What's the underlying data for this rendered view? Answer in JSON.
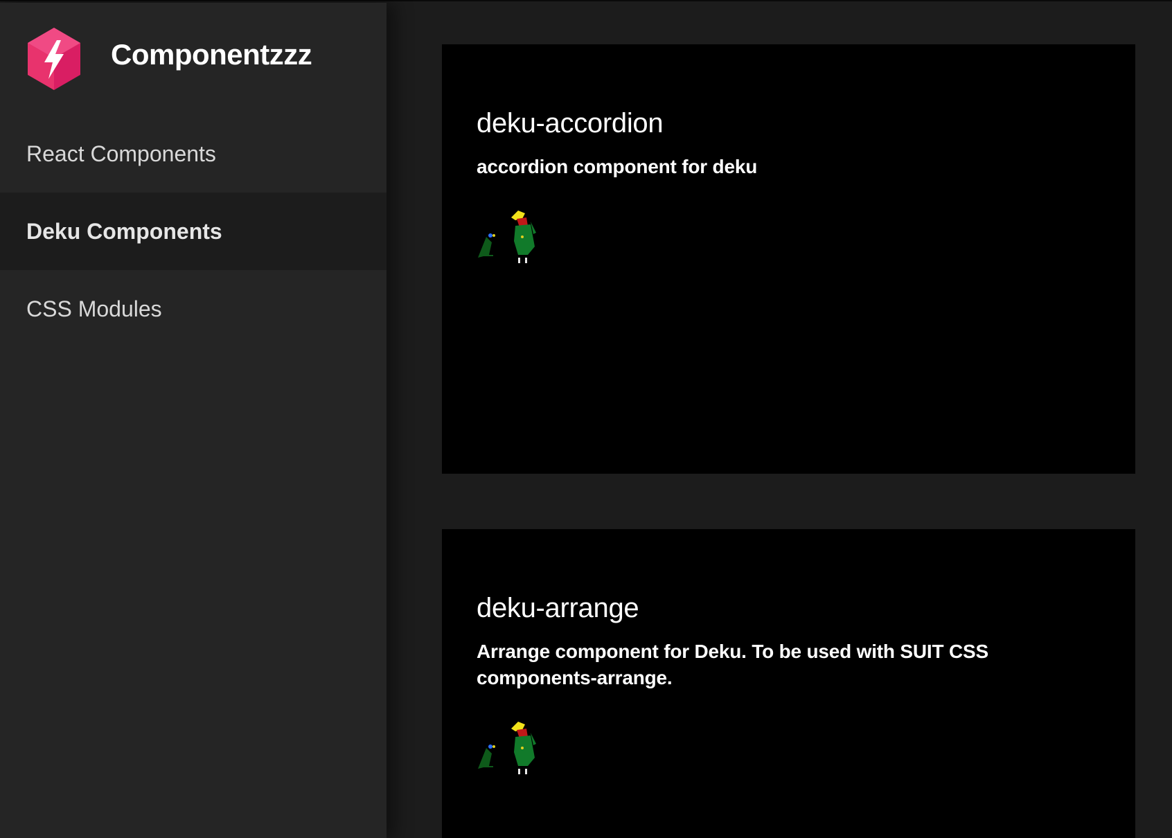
{
  "brand": {
    "title": "Componentzzz",
    "logo_icon": "bolt-hexagon-icon",
    "logo_color": "#e8336d"
  },
  "sidebar": {
    "items": [
      {
        "label": "React Components",
        "active": false
      },
      {
        "label": "Deku Components",
        "active": true
      },
      {
        "label": "CSS Modules",
        "active": false
      }
    ]
  },
  "main": {
    "cards": [
      {
        "title": "deku-accordion",
        "description": "accordion component for deku",
        "image_icon": "pixel-character-sprite-icon"
      },
      {
        "title": "deku-arrange",
        "description": "Arrange component for Deku. To be used with SUIT CSS components-arrange.",
        "image_icon": "pixel-character-sprite-icon"
      }
    ]
  },
  "colors": {
    "sidebar_bg": "#252525",
    "active_bg": "#1c1c1c",
    "main_bg": "#1c1c1c",
    "card_bg": "#000000",
    "text": "#ffffff"
  }
}
